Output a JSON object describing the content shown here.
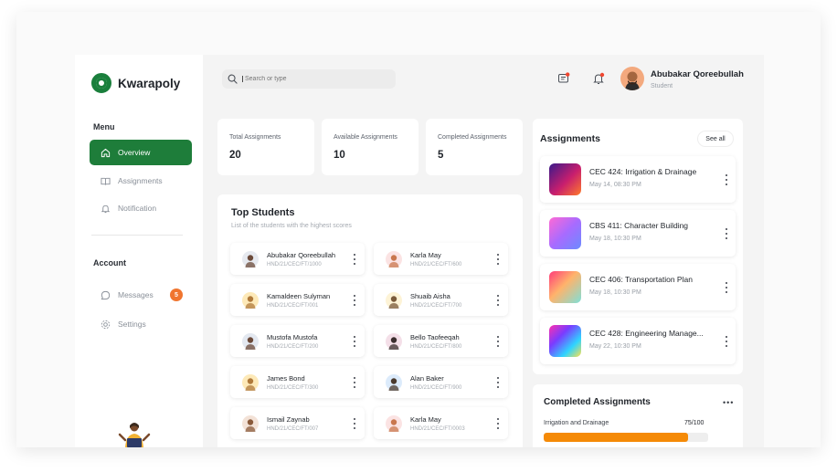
{
  "brand": {
    "name": "Kwarapoly"
  },
  "sidebar": {
    "menu_label": "Menu",
    "items": [
      {
        "label": "Overview",
        "icon": "home-icon",
        "active": true
      },
      {
        "label": "Assignments",
        "icon": "book-icon",
        "active": false
      },
      {
        "label": "Notification",
        "icon": "bell-icon",
        "active": false
      }
    ],
    "account_label": "Account",
    "account_items": [
      {
        "label": "Messages",
        "icon": "chat-icon",
        "badge": "5"
      },
      {
        "label": "Settings",
        "icon": "gear-icon"
      }
    ]
  },
  "header": {
    "search_placeholder": "Search or type",
    "user_name": "Abubakar Qoreebullah",
    "user_role": "Student"
  },
  "stats": [
    {
      "label": "Total Assignments",
      "value": "20"
    },
    {
      "label": "Available Assignments",
      "value": "10"
    },
    {
      "label": "Completed Assignments",
      "value": "5"
    }
  ],
  "top_students": {
    "title": "Top Students",
    "subtitle": "List of the students with the highest scores",
    "students": [
      {
        "name": "Abubakar Qoreebullah",
        "id": "HND/21/CEC/FT/1000"
      },
      {
        "name": "Karla May",
        "id": "HND/21/CEC/FT/600"
      },
      {
        "name": "Kamaldeen Sulyman",
        "id": "HND/21/CEC/FT/001"
      },
      {
        "name": "Shuaib Aisha",
        "id": "HND/21/CEC/FT/700"
      },
      {
        "name": "Mustofa Mustofa",
        "id": "HND/21/CEC/FT/200"
      },
      {
        "name": "Bello Taofeeqah",
        "id": "HND/21/CEC/FT/800"
      },
      {
        "name": "James Bond",
        "id": "HND/21/CEC/FT/300"
      },
      {
        "name": "Alan Baker",
        "id": "HND/21/CEC/FT/900"
      },
      {
        "name": "Ismail Zaynab",
        "id": "HND/21/CEC/FT/007"
      },
      {
        "name": "Karla May",
        "id": "HND/21/CEC/FT/0003"
      }
    ]
  },
  "assignments": {
    "title": "Assignments",
    "see_all": "See all",
    "items": [
      {
        "name": "CEC 424: Irrigation & Drainage",
        "date": "May 14, 08:30 PM"
      },
      {
        "name": "CBS 411: Character Building",
        "date": "May 18, 10:30 PM"
      },
      {
        "name": "CEC 406: Transportation Plan",
        "date": "May 18, 10:30 PM"
      },
      {
        "name": "CEC 428: Engineering Manage...",
        "date": "May 22, 10:30 PM"
      }
    ]
  },
  "completed": {
    "title": "Completed Assignments",
    "items": [
      {
        "name": "Irrigation and Drainage",
        "score_text": "75/100",
        "progress": 0.88
      }
    ]
  },
  "colors": {
    "brand_green": "#1e7d3a",
    "badge_orange": "#f0752f",
    "progress_orange": "#f58a07"
  }
}
